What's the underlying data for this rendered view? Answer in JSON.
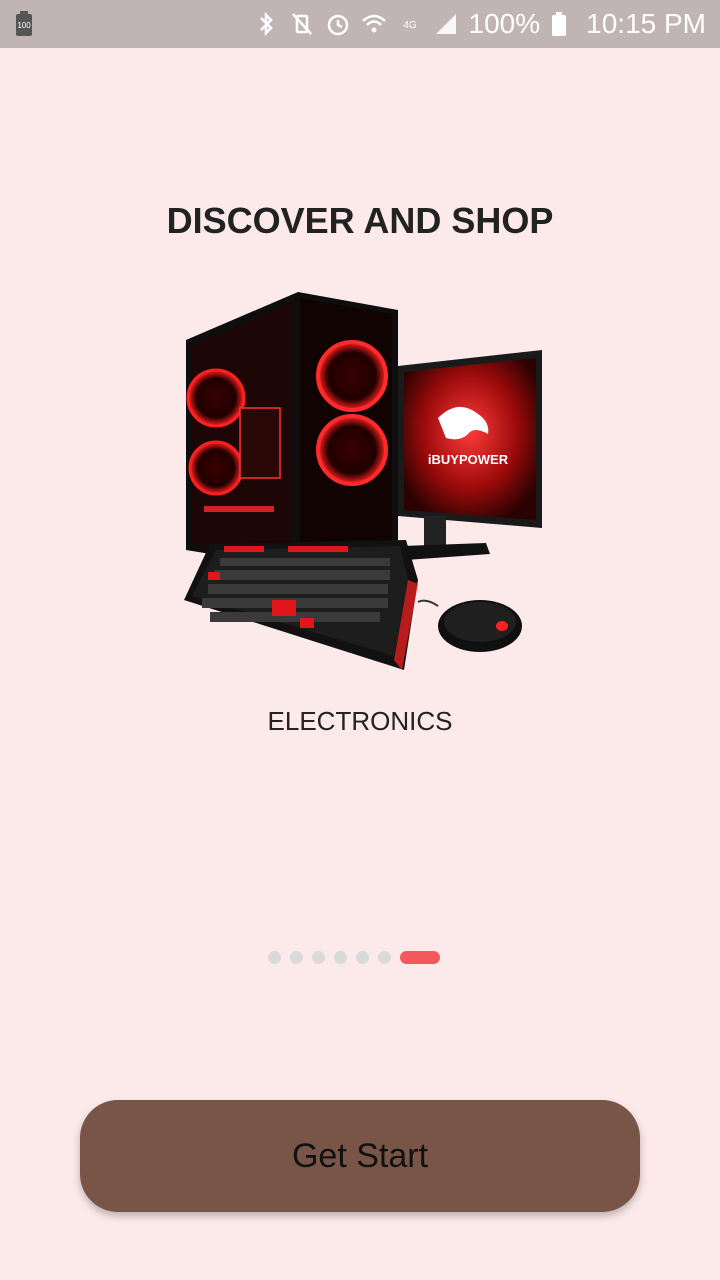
{
  "status_bar": {
    "battery_left_label": "100",
    "battery_percent": "100%",
    "time": "10:15 PM",
    "icons": [
      "battery-icon",
      "bluetooth-icon",
      "vibrate-mute-icon",
      "alarm-icon",
      "wifi-icon",
      "volte-icon",
      "signal-icon",
      "battery-icon"
    ]
  },
  "onboarding": {
    "title": "DISCOVER AND SHOP",
    "category": "ELECTRONICS",
    "page_indicator": {
      "total": 7,
      "active_index": 6
    },
    "hero_brand_text": "iBUYPOWER"
  },
  "actions": {
    "start_label": "Get Start"
  },
  "colors": {
    "background": "#fce9ea",
    "status_bar": "#c1b4b4",
    "button": "#795548",
    "active_dot": "#f4575c",
    "inactive_dot": "#dadada"
  }
}
